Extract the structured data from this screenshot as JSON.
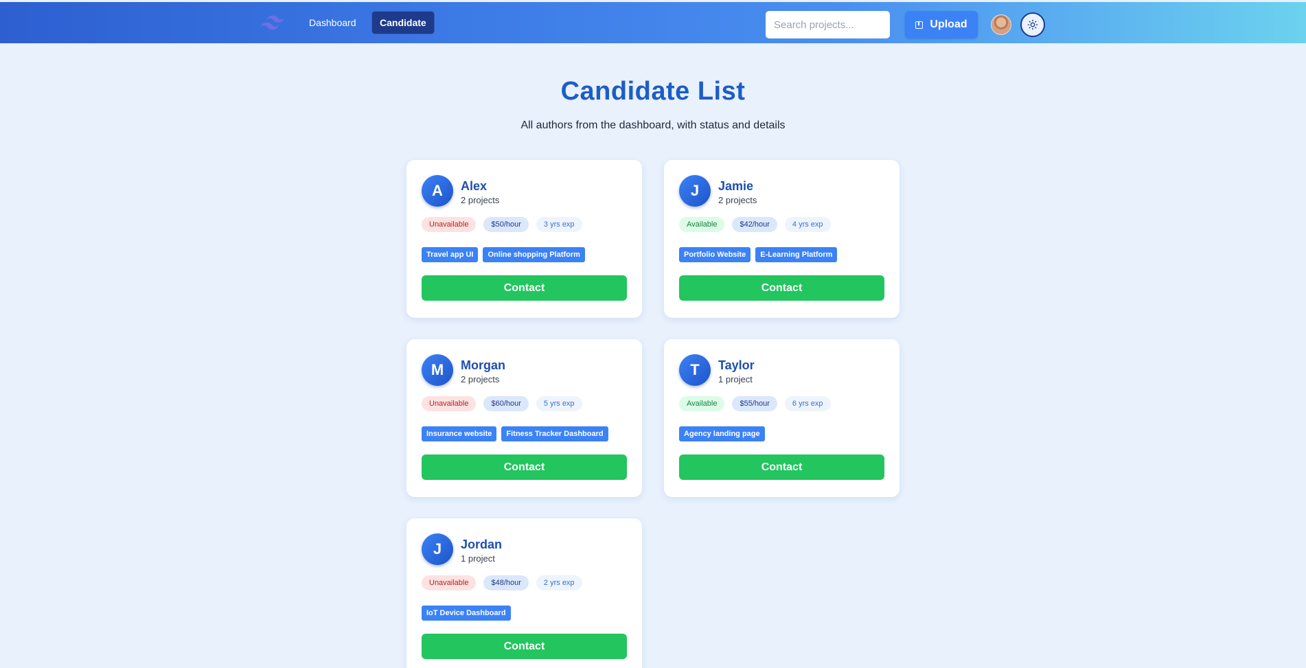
{
  "nav": {
    "logo_icon": "tailwind-logo-icon",
    "links": [
      {
        "label": "Dashboard",
        "active": false
      },
      {
        "label": "Candidate",
        "active": true
      }
    ],
    "search_placeholder": "Search projects...",
    "upload_label": "Upload",
    "upload_icon": "upload-icon",
    "theme_icon": "sun-icon"
  },
  "header": {
    "title": "Candidate List",
    "subtitle": "All authors from the dashboard, with status and details"
  },
  "colors": {
    "primary": "#3b82f6",
    "title": "#1d5dc7",
    "contact": "#22c55e",
    "background": "#e8f1fc"
  },
  "candidates": [
    {
      "initial": "A",
      "name": "Alex",
      "projects": "2 projects",
      "status": "Unavailable",
      "rate": "$50/hour",
      "experience": "3 yrs exp",
      "tags": [
        "Travel app UI",
        "Online shopping Platform"
      ],
      "contact_label": "Contact"
    },
    {
      "initial": "J",
      "name": "Jamie",
      "projects": "2 projects",
      "status": "Available",
      "rate": "$42/hour",
      "experience": "4 yrs exp",
      "tags": [
        "Portfolio Website",
        "E-Learning Platform"
      ],
      "contact_label": "Contact"
    },
    {
      "initial": "M",
      "name": "Morgan",
      "projects": "2 projects",
      "status": "Unavailable",
      "rate": "$60/hour",
      "experience": "5 yrs exp",
      "tags": [
        "Insurance website",
        "Fitness Tracker Dashboard"
      ],
      "contact_label": "Contact"
    },
    {
      "initial": "T",
      "name": "Taylor",
      "projects": "1 project",
      "status": "Available",
      "rate": "$55/hour",
      "experience": "6 yrs exp",
      "tags": [
        "Agency landing page"
      ],
      "contact_label": "Contact"
    },
    {
      "initial": "J",
      "name": "Jordan",
      "projects": "1 project",
      "status": "Unavailable",
      "rate": "$48/hour",
      "experience": "2 yrs exp",
      "tags": [
        "IoT Device Dashboard"
      ],
      "contact_label": "Contact"
    }
  ]
}
